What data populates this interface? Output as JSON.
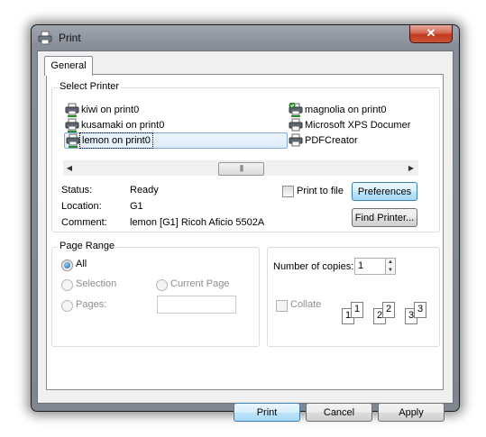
{
  "window": {
    "title": "Print",
    "close_glyph": "✕"
  },
  "tabs": [
    {
      "label": "General"
    }
  ],
  "select_printer": {
    "legend": "Select Printer",
    "printers": [
      {
        "name": "kiwi on print0",
        "icon": "network-printer-icon",
        "selected": false
      },
      {
        "name": "kusamaki on print0",
        "icon": "network-printer-icon",
        "selected": false
      },
      {
        "name": "lemon on print0",
        "icon": "network-printer-icon",
        "selected": true
      },
      {
        "name": "magnolia on print0",
        "icon": "default-printer-icon",
        "selected": false
      },
      {
        "name": "Microsoft XPS Documer",
        "icon": "printer-icon",
        "selected": false
      },
      {
        "name": "PDFCreator",
        "icon": "printer-icon",
        "selected": false
      }
    ],
    "scroll_left": "◀",
    "scroll_right": "▶",
    "scroll_grip": "|||",
    "status_label": "Status:",
    "status_value": "Ready",
    "location_label": "Location:",
    "location_value": "G1",
    "comment_label": "Comment:",
    "comment_value": "lemon [G1] Ricoh Aficio 5502A",
    "print_to_file_label": "Print to file",
    "print_to_file_checked": false,
    "preferences_label": "Preferences",
    "find_printer_label": "Find Printer..."
  },
  "page_range": {
    "legend": "Page Range",
    "all_label": "All",
    "selection_label": "Selection",
    "current_page_label": "Current Page",
    "pages_label": "Pages:",
    "pages_value": "",
    "selected_option": "All"
  },
  "copies": {
    "number_label": "Number of copies:",
    "number_value": "1",
    "collate_label": "Collate",
    "collate_checked": false,
    "collate_pages": [
      {
        "back": "1",
        "front": "1"
      },
      {
        "back": "2",
        "front": "2"
      },
      {
        "back": "3",
        "front": "3"
      }
    ]
  },
  "footer": {
    "print_label": "Print",
    "cancel_label": "Cancel",
    "apply_label": "Apply"
  },
  "colors": {
    "accent_border": "#3c7fb1",
    "selection_border": "#84acdd",
    "close_red": "#c2381d"
  }
}
